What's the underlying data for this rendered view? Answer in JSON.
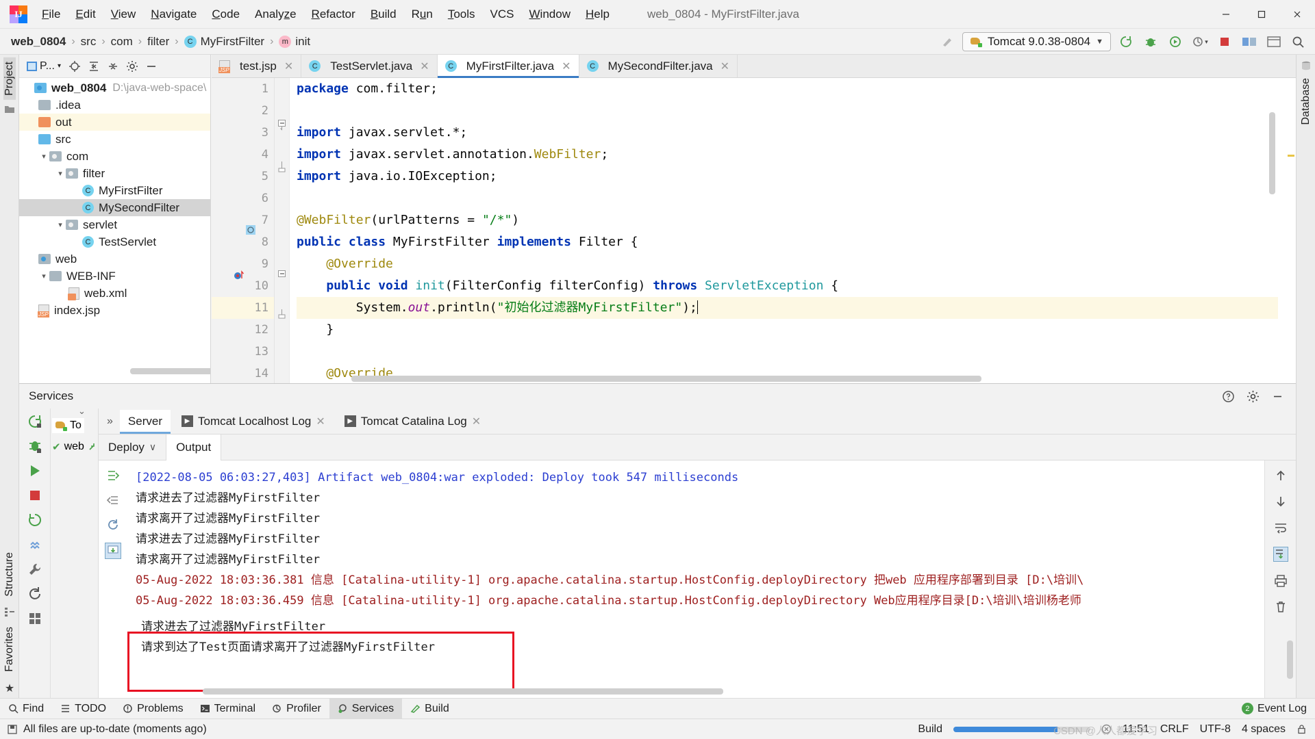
{
  "window": {
    "title": "web_0804 - MyFirstFilter.java",
    "app_icon": "intellij-idea-icon",
    "minimize": "─",
    "maximize": "❐",
    "close": "✕"
  },
  "menubar": {
    "items": [
      {
        "label": "File",
        "mnemonic": "F"
      },
      {
        "label": "Edit",
        "mnemonic": "E"
      },
      {
        "label": "View",
        "mnemonic": "V"
      },
      {
        "label": "Navigate",
        "mnemonic": "N"
      },
      {
        "label": "Code",
        "mnemonic": "C"
      },
      {
        "label": "Analyze",
        "mnemonic": "z"
      },
      {
        "label": "Refactor",
        "mnemonic": "R"
      },
      {
        "label": "Build",
        "mnemonic": "B"
      },
      {
        "label": "Run",
        "mnemonic": "u"
      },
      {
        "label": "Tools",
        "mnemonic": "T"
      },
      {
        "label": "VCS",
        "mnemonic": ""
      },
      {
        "label": "Window",
        "mnemonic": "W"
      },
      {
        "label": "Help",
        "mnemonic": "H"
      }
    ]
  },
  "navbar": {
    "breadcrumbs": [
      {
        "label": "web_0804",
        "icon": "",
        "bold": true
      },
      {
        "label": "src",
        "icon": ""
      },
      {
        "label": "com",
        "icon": ""
      },
      {
        "label": "filter",
        "icon": ""
      },
      {
        "label": "MyFirstFilter",
        "icon": "class-badge"
      },
      {
        "label": "init",
        "icon": "method-badge"
      }
    ],
    "separator": "›",
    "run_config": {
      "label": "Tomcat 9.0.38-0804",
      "icon": "tomcat-icon",
      "dropdown": "▼"
    },
    "buttons": [
      {
        "name": "build-hammer-icon"
      },
      {
        "name": "rerun-icon"
      },
      {
        "name": "debug-icon"
      },
      {
        "name": "run-with-coverage-icon"
      },
      {
        "name": "profiler-icon"
      },
      {
        "name": "stop-icon"
      },
      {
        "name": "update-app-icon"
      },
      {
        "name": "browser-icon"
      },
      {
        "name": "search-everywhere-icon"
      }
    ]
  },
  "left_strip": {
    "top": [
      {
        "label": "Project",
        "selected": true
      },
      {
        "label": "",
        "icon": "folder-icon"
      }
    ],
    "bottom": [
      {
        "label": "Structure"
      },
      {
        "label": "Favorites"
      }
    ]
  },
  "right_strip": {
    "items": [
      {
        "label": "Database"
      }
    ]
  },
  "project_panel": {
    "toolbar": {
      "selector_label": "P...",
      "selector_icon": "project-view-icon",
      "dropdown": "▾",
      "buttons": [
        {
          "name": "locate-icon"
        },
        {
          "name": "expand-all-icon"
        },
        {
          "name": "collapse-all-icon"
        },
        {
          "name": "settings-gear-icon"
        },
        {
          "name": "hide-icon"
        }
      ]
    },
    "tree": [
      {
        "name": "web_0804",
        "path": "D:\\java-web-space\\",
        "indent": 0,
        "icon": "module-icon",
        "arrow": "none",
        "bold": true,
        "state": "normal"
      },
      {
        "name": ".idea",
        "indent": 1,
        "icon": "folder-grey",
        "arrow": "none",
        "state": "normal"
      },
      {
        "name": "out",
        "indent": 1,
        "icon": "folder-orange",
        "arrow": "none",
        "state": "highlight"
      },
      {
        "name": "src",
        "indent": 1,
        "icon": "folder-blue",
        "arrow": "none",
        "state": "normal"
      },
      {
        "name": "com",
        "indent": 1,
        "icon": "package-icon",
        "arrow": "down",
        "state": "normal"
      },
      {
        "name": "filter",
        "indent": 2,
        "icon": "package-icon",
        "arrow": "down",
        "state": "normal"
      },
      {
        "name": "MyFirstFilter",
        "indent": 3,
        "icon": "class-icon",
        "arrow": "none",
        "state": "normal"
      },
      {
        "name": "MySecondFilter",
        "indent": 3,
        "icon": "class-icon",
        "arrow": "none",
        "state": "selected"
      },
      {
        "name": "servlet",
        "indent": 2,
        "icon": "package-icon",
        "arrow": "down",
        "state": "normal"
      },
      {
        "name": "TestServlet",
        "indent": 3,
        "icon": "class-icon",
        "arrow": "none",
        "state": "normal"
      },
      {
        "name": "web",
        "indent": 1,
        "icon": "module-icon",
        "arrow": "none",
        "state": "normal"
      },
      {
        "name": "WEB-INF",
        "indent": 1,
        "icon": "folder-grey",
        "arrow": "down",
        "state": "normal"
      },
      {
        "name": "web.xml",
        "indent": 2,
        "icon": "xml-file-icon",
        "arrow": "none",
        "state": "normal"
      },
      {
        "name": "index.jsp",
        "indent": 1,
        "icon": "jsp-file-icon",
        "arrow": "none",
        "state": "normal"
      }
    ]
  },
  "editor": {
    "tabs": [
      {
        "label": "test.jsp",
        "icon": "jsp-file-icon",
        "active": false,
        "close": "✕"
      },
      {
        "label": "TestServlet.java",
        "icon": "class-icon",
        "active": false,
        "close": "✕"
      },
      {
        "label": "MyFirstFilter.java",
        "icon": "class-icon",
        "active": true,
        "close": "✕"
      },
      {
        "label": "MySecondFilter.java",
        "icon": "class-icon",
        "active": false,
        "close": "✕"
      }
    ],
    "inspection": {
      "warning_count": "1",
      "icon": "warning-triangle-icon",
      "up": "∧",
      "down": "∨"
    },
    "lines": [
      {
        "n": "1",
        "tokens": [
          {
            "t": "package ",
            "c": "kw"
          },
          {
            "t": "com.filter;",
            "c": "pln"
          }
        ]
      },
      {
        "n": "2",
        "tokens": []
      },
      {
        "n": "3",
        "fold": "start",
        "tokens": [
          {
            "t": "import ",
            "c": "kw"
          },
          {
            "t": "javax.servlet.*;",
            "c": "pln"
          }
        ]
      },
      {
        "n": "4",
        "tokens": [
          {
            "t": "import ",
            "c": "kw"
          },
          {
            "t": "javax.servlet.annotation.",
            "c": "pln"
          },
          {
            "t": "WebFilter",
            "c": "anno"
          },
          {
            "t": ";",
            "c": "pln"
          }
        ]
      },
      {
        "n": "5",
        "fold": "end",
        "tokens": [
          {
            "t": "import ",
            "c": "kw"
          },
          {
            "t": "java.io.IOException;",
            "c": "pln"
          }
        ]
      },
      {
        "n": "6",
        "tokens": []
      },
      {
        "n": "7",
        "tokens": [
          {
            "t": "@WebFilter",
            "c": "anno"
          },
          {
            "t": "(urlPatterns = ",
            "c": "pln"
          },
          {
            "t": "\"/*\"",
            "c": "str"
          },
          {
            "t": ")",
            "c": "pln"
          }
        ]
      },
      {
        "n": "8",
        "mark": "class-impl-icon",
        "tokens": [
          {
            "t": "public class ",
            "c": "kw"
          },
          {
            "t": "MyFirstFilter ",
            "c": "pln"
          },
          {
            "t": "implements ",
            "c": "kw"
          },
          {
            "t": "Filter {",
            "c": "pln"
          }
        ]
      },
      {
        "n": "9",
        "tokens": [
          {
            "t": "    @Override",
            "c": "anno"
          }
        ]
      },
      {
        "n": "10",
        "mark": "breakpoint-icon",
        "fold": "start",
        "tokens": [
          {
            "t": "    public void ",
            "c": "kw"
          },
          {
            "t": "init",
            "c": "typ"
          },
          {
            "t": "(FilterConfig filterConfig) ",
            "c": "pln"
          },
          {
            "t": "throws ",
            "c": "kw"
          },
          {
            "t": "ServletException",
            "c": "typ"
          },
          {
            "t": " {",
            "c": "pln"
          }
        ]
      },
      {
        "n": "11",
        "highlight": true,
        "caret": true,
        "tokens": [
          {
            "t": "        System.",
            "c": "pln"
          },
          {
            "t": "out",
            "c": "fld"
          },
          {
            "t": ".println(",
            "c": "pln"
          },
          {
            "t": "\"初始化过滤器MyFirstFilter\"",
            "c": "str"
          },
          {
            "t": ");",
            "c": "pln"
          }
        ]
      },
      {
        "n": "12",
        "fold": "end",
        "tokens": [
          {
            "t": "    }",
            "c": "pln"
          }
        ]
      },
      {
        "n": "13",
        "tokens": []
      },
      {
        "n": "14",
        "tokens": [
          {
            "t": "    @Override",
            "c": "anno"
          }
        ]
      }
    ]
  },
  "services": {
    "title": "Services",
    "header_icons": [
      {
        "name": "help-icon"
      },
      {
        "name": "settings-gear-icon"
      },
      {
        "name": "hide-icon"
      }
    ],
    "left_tools": [
      {
        "name": "rerun-icon"
      },
      {
        "name": "debug-icon"
      },
      {
        "name": "run-icon"
      },
      {
        "name": "stop-icon"
      },
      {
        "name": "redeploy-icon"
      },
      {
        "name": "filter-icon"
      },
      {
        "name": "wrench-icon"
      },
      {
        "name": "refresh-icon"
      },
      {
        "name": "grid-icon"
      }
    ],
    "tree": {
      "root_label": "To",
      "child_label": "web",
      "child_status_icon": "check-icon",
      "child_deploy_icon": "deploy-icon"
    },
    "tabs": [
      {
        "label": "Server",
        "active": true,
        "icon": "",
        "close": ""
      },
      {
        "label": "Tomcat Localhost Log",
        "active": false,
        "icon": "log-icon",
        "close": "✕"
      },
      {
        "label": "Tomcat Catalina Log",
        "active": false,
        "icon": "log-icon",
        "close": "✕"
      }
    ],
    "subtabs": [
      {
        "label": "Deploy",
        "active": false,
        "dropdown": "∨"
      },
      {
        "label": "Output",
        "active": true,
        "dropdown": ""
      }
    ],
    "console_tools_left": [
      {
        "name": "scroll-to-end-icon"
      },
      {
        "name": "scroll-up-icon"
      },
      {
        "name": "restart-icon"
      },
      {
        "name": "download-icon"
      }
    ],
    "console_tools_right": [
      {
        "name": "up-arrow-icon"
      },
      {
        "name": "down-arrow-icon"
      },
      {
        "name": "soft-wrap-icon"
      },
      {
        "name": "scroll-to-end-icon"
      },
      {
        "name": "print-icon"
      },
      {
        "name": "trash-icon"
      }
    ],
    "console_lines": [
      {
        "text": "[2022-08-05 06:03:27,403] Artifact web_0804:war exploded: Deploy took 547 milliseconds",
        "color": "blue"
      },
      {
        "text": "请求进去了过滤器MyFirstFilter",
        "color": "black"
      },
      {
        "text": "请求离开了过滤器MyFirstFilter",
        "color": "black"
      },
      {
        "text": "请求进去了过滤器MyFirstFilter",
        "color": "black"
      },
      {
        "text": "请求离开了过滤器MyFirstFilter",
        "color": "black"
      },
      {
        "text": "05-Aug-2022 18:03:36.381 信息 [Catalina-utility-1] org.apache.catalina.startup.HostConfig.deployDirectory 把web 应用程序部署到目录 [D:\\培训\\",
        "color": "red"
      },
      {
        "text": "05-Aug-2022 18:03:36.459 信息 [Catalina-utility-1] org.apache.catalina.startup.HostConfig.deployDirectory Web应用程序目录[D:\\培训\\培训杨老师",
        "color": "red"
      },
      {
        "text": "请求进去了过滤器MyFirstFilter",
        "color": "black",
        "boxed": true
      },
      {
        "text": "请求到达了Test页面请求离开了过滤器MyFirstFilter",
        "color": "black",
        "boxed": true
      }
    ],
    "highlight_box_color": "#e81123"
  },
  "toolwindow_bar": {
    "items": [
      {
        "label": "Find",
        "icon": "search-icon",
        "active": false
      },
      {
        "label": "TODO",
        "icon": "todo-icon",
        "active": false
      },
      {
        "label": "Problems",
        "icon": "problems-icon",
        "active": false
      },
      {
        "label": "Terminal",
        "icon": "terminal-icon",
        "active": false
      },
      {
        "label": "Profiler",
        "icon": "profiler-icon",
        "active": false
      },
      {
        "label": "Services",
        "icon": "services-icon",
        "active": true
      },
      {
        "label": "Build",
        "icon": "build-icon",
        "active": false
      }
    ],
    "event_log": {
      "label": "Event Log",
      "badge": "2"
    }
  },
  "statusbar": {
    "message": "All files are up-to-date (moments ago)",
    "message_icon": "save-icon",
    "build_label": "Build",
    "progress_percent": 76,
    "cancel_icon": "cancel-icon",
    "time": "11:51",
    "line_separator": "CRLF",
    "encoding": "UTF-8",
    "indent": "4 spaces",
    "lock_icon": "lock-icon",
    "watermark": "CSDN @人人都爱学习"
  }
}
